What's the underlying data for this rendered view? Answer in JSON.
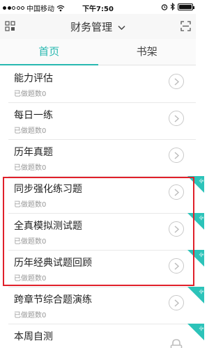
{
  "status_bar": {
    "carrier": "中国移动",
    "time": "下午7:50"
  },
  "header": {
    "title": "财务管理",
    "left_icon": "grid-icon",
    "right_icon": "scan-icon",
    "title_icon": "chevron-down-icon"
  },
  "tabs": [
    {
      "label": "首页",
      "active": true
    },
    {
      "label": "书架",
      "active": false
    }
  ],
  "list": [
    {
      "title": "能力评估",
      "subtitle": "已做题数0",
      "badge": "",
      "locked": false
    },
    {
      "title": "每日一练",
      "subtitle": "已做题数0",
      "badge": "",
      "locked": false
    },
    {
      "title": "历年真题",
      "subtitle": "已做题数0",
      "badge": "",
      "locked": false
    },
    {
      "title": "同步强化练习题",
      "subtitle": "已做题数0",
      "badge": "试",
      "locked": false
    },
    {
      "title": "全真模拟测试题",
      "subtitle": "已做题数0",
      "badge": "试",
      "locked": false
    },
    {
      "title": "历年经典试题回顾",
      "subtitle": "已做题数0",
      "badge": "试",
      "locked": false
    },
    {
      "title": "跨章节综合题演练",
      "subtitle": "已做题数0",
      "badge": "试",
      "locked": false
    },
    {
      "title": "本周自测",
      "subtitle": "",
      "badge": "试",
      "locked": true
    }
  ],
  "colors": {
    "accent": "#28b8b0",
    "highlight": "#e0202a"
  }
}
